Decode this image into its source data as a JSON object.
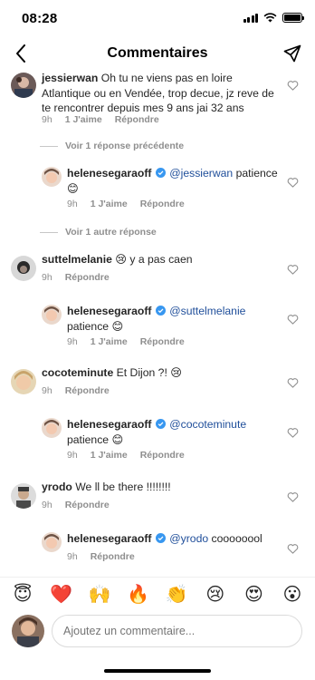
{
  "status": {
    "time": "08:28"
  },
  "nav": {
    "title": "Commentaires"
  },
  "labels": {
    "like": "J'aime",
    "reply": "Répondre"
  },
  "comments": [
    {
      "username": "jessierwan",
      "text": "Oh tu ne viens pas en loire Atlantique ou en Vendée, trop decue, jz reve de te rencontrer depuis mes 9 ans jai 32 ans",
      "time": "9h",
      "likes": "1 J'aime"
    },
    {
      "thread_link": "Voir 1 réponse précédente"
    },
    {
      "username": "helenesegaraoff",
      "mention": "@jessierwan",
      "text": " patience 😊",
      "time": "9h",
      "likes": "1 J'aime"
    },
    {
      "thread_link": "Voir 1 autre réponse"
    },
    {
      "username": "suttelmelanie",
      "text": " 😢  y a pas caen",
      "time": "9h"
    },
    {
      "username": "helenesegaraoff",
      "mention": "@suttelmelanie",
      "text": " patience 😊",
      "time": "9h",
      "likes": "1 J'aime"
    },
    {
      "username": "cocoteminute",
      "text": " Et Dijon ?! 😢",
      "time": "9h"
    },
    {
      "username": "helenesegaraoff",
      "mention": "@cocoteminute",
      "text": " patience 😊",
      "time": "9h",
      "likes": "1 J'aime"
    },
    {
      "username": "yrodo",
      "text": " We ll be there !!!!!!!!",
      "time": "9h"
    },
    {
      "username": "helenesegaraoff",
      "mention": "@yrodo",
      "text": " coooooool",
      "time": "9h"
    }
  ],
  "emoji_bar": [
    "😇",
    "❤️",
    "🙌",
    "🔥",
    "👏",
    "😢",
    "😍",
    "😮"
  ],
  "composer": {
    "placeholder": "Ajoutez un commentaire..."
  },
  "colors": {
    "verified": "#3897f0",
    "mention": "#1f4e9a",
    "muted": "#8e8e8e"
  }
}
